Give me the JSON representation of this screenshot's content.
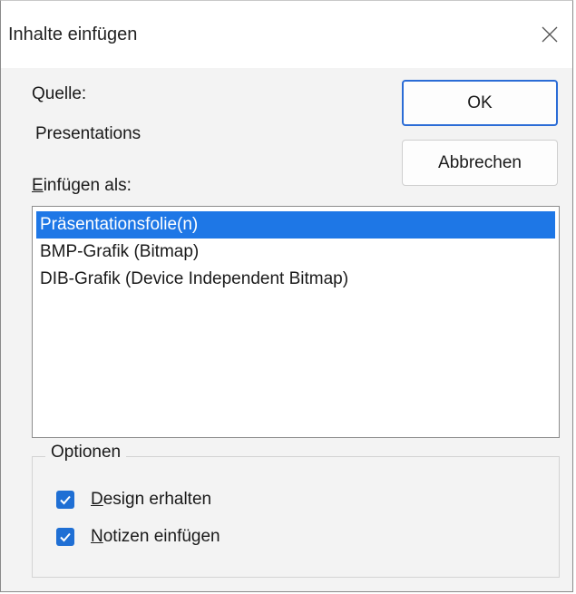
{
  "window": {
    "title": "Inhalte einfügen",
    "close_icon": "close-icon"
  },
  "source": {
    "label": "Quelle:",
    "value": "Presentations"
  },
  "paste_as": {
    "label": "Einfügen als:",
    "items": [
      {
        "label": "Präsentationsfolie(n)",
        "selected": true
      },
      {
        "label": "BMP-Grafik (Bitmap)",
        "selected": false
      },
      {
        "label": "DIB-Grafik (Device Independent Bitmap)",
        "selected": false
      }
    ]
  },
  "buttons": {
    "ok": "OK",
    "cancel": "Abbrechen"
  },
  "options": {
    "legend": "Optionen",
    "keep_design": {
      "label": "Design erhalten",
      "checked": true
    },
    "insert_notes": {
      "label": "Notizen einfügen",
      "checked": true
    }
  },
  "colors": {
    "accent": "#1e77e6",
    "checkbox": "#1f6fd4",
    "default_button_border": "#2b6cd6"
  }
}
